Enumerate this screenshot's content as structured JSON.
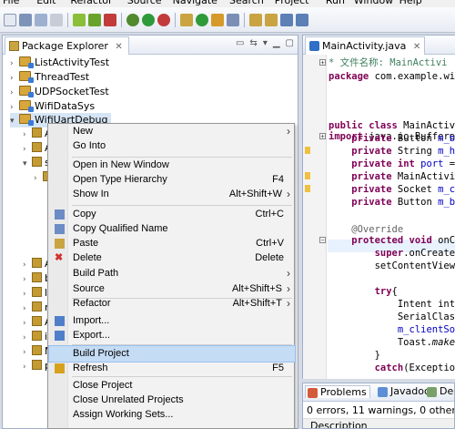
{
  "menubar": [
    "File",
    "Edit",
    "Refactor",
    "Source",
    "Navigate",
    "Search",
    "Project",
    "Run",
    "Window",
    "Help"
  ],
  "package_explorer": {
    "title": "Package Explorer",
    "projects": [
      "ListActivityTest",
      "ThreadTest",
      "UDPSocketTest",
      "WifiDataSys",
      "WifiUartDebug"
    ],
    "child_stubs": [
      "A",
      "A",
      "s",
      "g",
      "A",
      "b",
      "li",
      "r",
      "A",
      "i",
      "M",
      "p"
    ]
  },
  "editor": {
    "tab_title": "MainActivity.java",
    "lines": [
      {
        "parts": [
          [
            "cm",
            "* 文件名称: MainActivi"
          ]
        ]
      },
      {
        "parts": [
          [
            "kw",
            "package"
          ],
          [
            "",
            " com.example.wif"
          ]
        ]
      },
      {
        "parts": [
          [
            "",
            ""
          ]
        ]
      },
      {
        "parts": [
          [
            "kw",
            "import"
          ],
          [
            "",
            " java.io.Buffered"
          ]
        ]
      },
      {
        "parts": [
          [
            "",
            ""
          ]
        ]
      },
      {
        "parts": [
          [
            "kw",
            "public class"
          ],
          [
            "",
            " MainActivi"
          ]
        ]
      },
      {
        "parts": [
          [
            "",
            "    "
          ],
          [
            "kw",
            "private"
          ],
          [
            "",
            " Button "
          ],
          [
            "fld",
            "m_bu"
          ]
        ]
      },
      {
        "parts": [
          [
            "",
            "    "
          ],
          [
            "kw",
            "private"
          ],
          [
            "",
            " String "
          ],
          [
            "fld",
            "m_ho"
          ]
        ]
      },
      {
        "parts": [
          [
            "",
            "    "
          ],
          [
            "kw",
            "private int"
          ],
          [
            "",
            " "
          ],
          [
            "fld",
            "port"
          ],
          [
            "",
            " ="
          ]
        ]
      },
      {
        "parts": [
          [
            "",
            "    "
          ],
          [
            "kw",
            "private"
          ],
          [
            "",
            " MainActivit"
          ]
        ]
      },
      {
        "parts": [
          [
            "",
            "    "
          ],
          [
            "kw",
            "private"
          ],
          [
            "",
            " Socket "
          ],
          [
            "fld",
            "m_cl"
          ]
        ]
      },
      {
        "parts": [
          [
            "",
            "    "
          ],
          [
            "kw",
            "private"
          ],
          [
            "",
            " Button "
          ],
          [
            "fld",
            "m_bu"
          ]
        ]
      },
      {
        "parts": [
          [
            "",
            ""
          ]
        ]
      },
      {
        "parts": [
          [
            "ann",
            "    @Override"
          ]
        ]
      },
      {
        "parts": [
          [
            "",
            "    "
          ],
          [
            "kw",
            "protected void"
          ],
          [
            "",
            " onCr"
          ]
        ]
      },
      {
        "parts": [
          [
            "",
            "        "
          ],
          [
            "kw",
            "super"
          ],
          [
            "",
            ".onCreate"
          ]
        ]
      },
      {
        "parts": [
          [
            "",
            "        setContentView"
          ]
        ]
      },
      {
        "parts": [
          [
            "",
            ""
          ]
        ]
      },
      {
        "parts": [
          [
            "",
            "        "
          ],
          [
            "kw",
            "try"
          ],
          [
            "",
            "{"
          ]
        ]
      },
      {
        "parts": [
          [
            "",
            "            Intent inte"
          ]
        ]
      },
      {
        "parts": [
          [
            "",
            "            SerialClass"
          ]
        ]
      },
      {
        "parts": [
          [
            "",
            "            "
          ],
          [
            "fld",
            "m_clientSoc"
          ]
        ]
      },
      {
        "parts": [
          [
            "",
            "            Toast."
          ],
          [
            "it",
            "make"
          ]
        ]
      },
      {
        "parts": [
          [
            "",
            "        }"
          ]
        ]
      },
      {
        "parts": [
          [
            "",
            "        "
          ],
          [
            "kw",
            "catch"
          ],
          [
            "",
            "(Exceptio"
          ]
        ]
      }
    ]
  },
  "problems": {
    "tabs": [
      "Problems",
      "Javadoc",
      "Dec"
    ],
    "summary": "0 errors, 11 warnings, 0 others",
    "column_header": "Description"
  },
  "context_menu": {
    "items": [
      {
        "label": "New",
        "shortcut": "",
        "submenu": true,
        "icon": ""
      },
      {
        "label": "Go Into",
        "shortcut": "",
        "submenu": false,
        "icon": ""
      },
      {
        "sep": true
      },
      {
        "label": "Open in New Window",
        "shortcut": "",
        "submenu": false,
        "icon": ""
      },
      {
        "label": "Open Type Hierarchy",
        "shortcut": "F4",
        "submenu": false,
        "icon": ""
      },
      {
        "label": "Show In",
        "shortcut": "Alt+Shift+W",
        "submenu": true,
        "icon": ""
      },
      {
        "sep": true
      },
      {
        "label": "Copy",
        "shortcut": "Ctrl+C",
        "submenu": false,
        "icon": "copy-icon"
      },
      {
        "label": "Copy Qualified Name",
        "shortcut": "",
        "submenu": false,
        "icon": "copy-qualified-icon"
      },
      {
        "label": "Paste",
        "shortcut": "Ctrl+V",
        "submenu": false,
        "icon": "paste-icon"
      },
      {
        "label": "Delete",
        "shortcut": "Delete",
        "submenu": false,
        "icon": "delete-icon"
      },
      {
        "sep": true
      },
      {
        "label": "Build Path",
        "shortcut": "",
        "submenu": true,
        "icon": ""
      },
      {
        "label": "Source",
        "shortcut": "Alt+Shift+S",
        "submenu": true,
        "icon": ""
      },
      {
        "label": "Refactor",
        "shortcut": "Alt+Shift+T",
        "submenu": true,
        "icon": ""
      },
      {
        "sep": true
      },
      {
        "label": "Import...",
        "shortcut": "",
        "submenu": false,
        "icon": "import-icon"
      },
      {
        "label": "Export...",
        "shortcut": "",
        "submenu": false,
        "icon": "export-icon"
      },
      {
        "sep": true
      },
      {
        "label": "Build Project",
        "shortcut": "",
        "submenu": false,
        "icon": "",
        "highlighted": true
      },
      {
        "label": "Refresh",
        "shortcut": "F5",
        "submenu": false,
        "icon": "refresh-icon"
      },
      {
        "label": "Close Project",
        "shortcut": "",
        "submenu": false,
        "icon": ""
      },
      {
        "label": "Close Unrelated Projects",
        "shortcut": "",
        "submenu": false,
        "icon": ""
      },
      {
        "label": "Assign Working Sets...",
        "shortcut": "",
        "submenu": false,
        "icon": ""
      }
    ]
  }
}
